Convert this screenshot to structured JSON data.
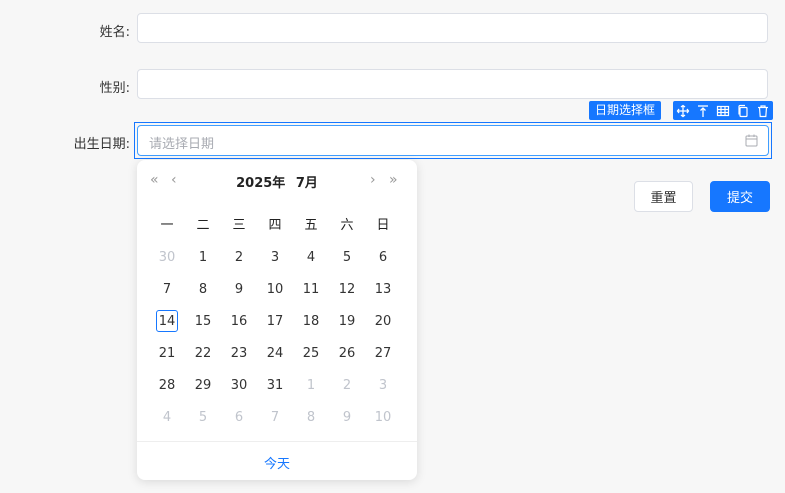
{
  "form": {
    "name_label": "姓名:",
    "gender_label": "性别:",
    "birth_label": "出生日期:",
    "birth_placeholder": "请选择日期"
  },
  "toolbar": {
    "tag_label": "日期选择框",
    "icons": [
      "move-icon",
      "align-top-icon",
      "table-icon",
      "copy-icon",
      "delete-icon"
    ]
  },
  "buttons": {
    "reset": "重置",
    "submit": "提交"
  },
  "calendar": {
    "year": "2025年",
    "month": "7月",
    "nav": {
      "prev_year": "«",
      "prev_month": "‹",
      "next_month": "›",
      "next_year": "»"
    },
    "weekdays": [
      "一",
      "二",
      "三",
      "四",
      "五",
      "六",
      "日"
    ],
    "days": [
      {
        "d": "30",
        "m": true
      },
      {
        "d": "1"
      },
      {
        "d": "2"
      },
      {
        "d": "3"
      },
      {
        "d": "4"
      },
      {
        "d": "5"
      },
      {
        "d": "6"
      },
      {
        "d": "7"
      },
      {
        "d": "8"
      },
      {
        "d": "9"
      },
      {
        "d": "10"
      },
      {
        "d": "11"
      },
      {
        "d": "12"
      },
      {
        "d": "13"
      },
      {
        "d": "14",
        "today": true
      },
      {
        "d": "15"
      },
      {
        "d": "16"
      },
      {
        "d": "17"
      },
      {
        "d": "18"
      },
      {
        "d": "19"
      },
      {
        "d": "20"
      },
      {
        "d": "21"
      },
      {
        "d": "22"
      },
      {
        "d": "23"
      },
      {
        "d": "24"
      },
      {
        "d": "25"
      },
      {
        "d": "26"
      },
      {
        "d": "27"
      },
      {
        "d": "28"
      },
      {
        "d": "29"
      },
      {
        "d": "30"
      },
      {
        "d": "31"
      },
      {
        "d": "1",
        "m": true
      },
      {
        "d": "2",
        "m": true
      },
      {
        "d": "3",
        "m": true
      },
      {
        "d": "4",
        "m": true
      },
      {
        "d": "5",
        "m": true
      },
      {
        "d": "6",
        "m": true
      },
      {
        "d": "7",
        "m": true
      },
      {
        "d": "8",
        "m": true
      },
      {
        "d": "9",
        "m": true
      },
      {
        "d": "10",
        "m": true
      }
    ],
    "today_label": "今天"
  },
  "colors": {
    "accent": "#1677ff",
    "muted": "#c0c4cc"
  }
}
